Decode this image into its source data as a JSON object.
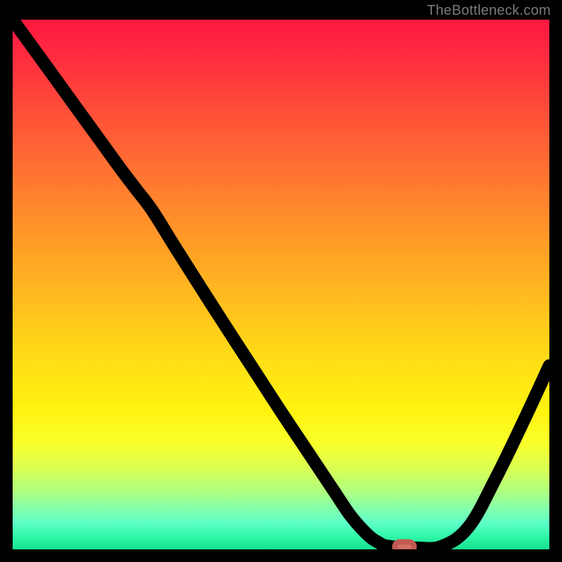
{
  "watermark": "TheBottleneck.com",
  "colors": {
    "bg": "#000000",
    "watermark": "#7a7a7a",
    "curve": "#000000",
    "marker_fill": "#d47066",
    "marker_stroke": "#c25a52"
  },
  "chart_data": {
    "type": "line",
    "title": "",
    "xlabel": "",
    "ylabel": "",
    "xlim": [
      0,
      100
    ],
    "ylim": [
      0,
      100
    ],
    "x": [
      0,
      5,
      10,
      15,
      20,
      23,
      26,
      30,
      35,
      40,
      45,
      50,
      55,
      60,
      63,
      66,
      68,
      70,
      75,
      80,
      85,
      90,
      95,
      100
    ],
    "y": [
      100,
      93,
      86,
      79,
      72,
      68,
      64,
      57.5,
      49.5,
      41.6,
      33.8,
      26,
      18.4,
      10.8,
      6.3,
      2.9,
      1.4,
      0.6,
      0.3,
      0.6,
      4.3,
      13.4,
      23.8,
      34.7
    ],
    "marker": {
      "x": 73,
      "y": 0.5
    },
    "annotations": []
  }
}
